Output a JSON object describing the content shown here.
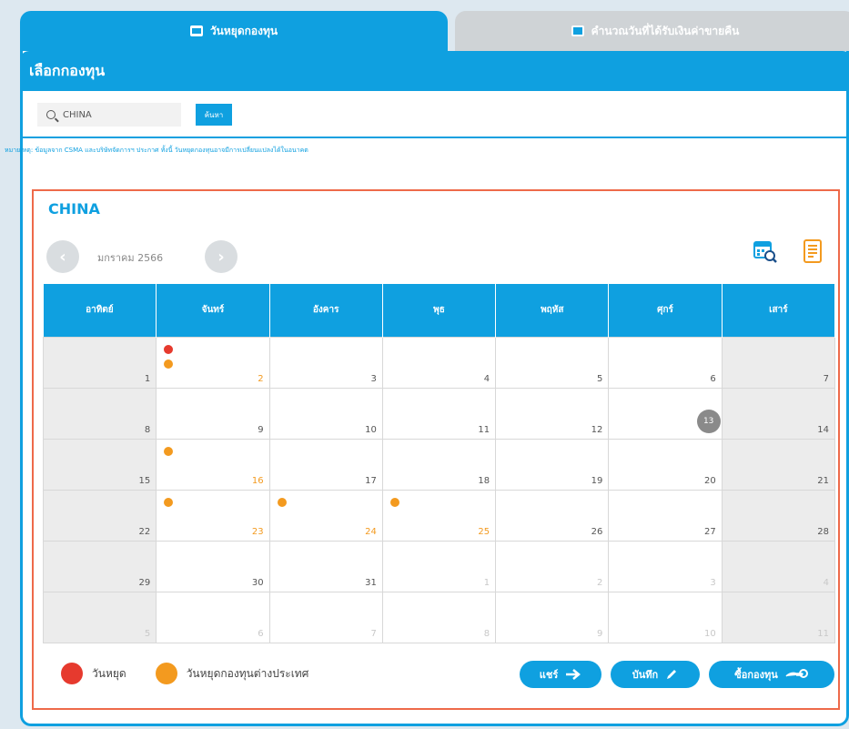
{
  "tabs": {
    "active_label": "วันหยุดกองทุน",
    "inactive_label": "คำนวณวันที่ได้รับเงินค่าขายคืน"
  },
  "panel": {
    "title": "เลือกกองทุน"
  },
  "search": {
    "value": "CHINA",
    "button_label": "ค้นหา"
  },
  "note": "หมายเหตุ: ข้อมูลจาก CSMA และบริษัทจัดการฯ ประกาศ ทั้งนี้ วันหยุดกองทุนอาจมีการเปลี่ยนแปลงได้ในอนาคต",
  "calendar": {
    "fund_name": "CHINA",
    "month_label": "มกราคม 2566",
    "weekdays": [
      "อาทิตย์",
      "จันทร์",
      "อังคาร",
      "พุธ",
      "พฤหัส",
      "ศุกร์",
      "เสาร์"
    ],
    "weeks": [
      [
        {
          "d": "1"
        },
        {
          "d": "2",
          "h": true,
          "dots": [
            "red",
            "orange"
          ]
        },
        {
          "d": "3"
        },
        {
          "d": "4"
        },
        {
          "d": "5"
        },
        {
          "d": "6"
        },
        {
          "d": "7"
        }
      ],
      [
        {
          "d": "8"
        },
        {
          "d": "9"
        },
        {
          "d": "10"
        },
        {
          "d": "11"
        },
        {
          "d": "12"
        },
        {
          "d": "13",
          "today": true
        },
        {
          "d": "14"
        }
      ],
      [
        {
          "d": "15"
        },
        {
          "d": "16",
          "h": true,
          "dots": [
            "orange"
          ]
        },
        {
          "d": "17"
        },
        {
          "d": "18"
        },
        {
          "d": "19"
        },
        {
          "d": "20"
        },
        {
          "d": "21"
        }
      ],
      [
        {
          "d": "22"
        },
        {
          "d": "23",
          "h": true,
          "dots": [
            "orange"
          ]
        },
        {
          "d": "24",
          "h": true,
          "dots": [
            "orange"
          ]
        },
        {
          "d": "25",
          "h": true,
          "dots": [
            "orange"
          ]
        },
        {
          "d": "26"
        },
        {
          "d": "27"
        },
        {
          "d": "28"
        }
      ],
      [
        {
          "d": "29"
        },
        {
          "d": "30"
        },
        {
          "d": "31"
        },
        {
          "d": "1",
          "o": true
        },
        {
          "d": "2",
          "o": true
        },
        {
          "d": "3",
          "o": true
        },
        {
          "d": "4",
          "o": true
        }
      ],
      [
        {
          "d": "5",
          "o": true
        },
        {
          "d": "6",
          "o": true
        },
        {
          "d": "7",
          "o": true
        },
        {
          "d": "8",
          "o": true
        },
        {
          "d": "9",
          "o": true
        },
        {
          "d": "10",
          "o": true
        },
        {
          "d": "11",
          "o": true
        }
      ]
    ]
  },
  "legend": {
    "holiday": "วันหยุด",
    "foreign_holiday": "วันหยุดกองทุนต่างประเทศ"
  },
  "actions": {
    "share": "แชร์",
    "save": "บันทึก",
    "buy": "ซื้อกองทุน"
  },
  "colors": {
    "accent": "#0fa0e0",
    "holiday": "#e63a2e",
    "foreign_holiday": "#f39a1f",
    "frame": "#ee6a4a"
  }
}
